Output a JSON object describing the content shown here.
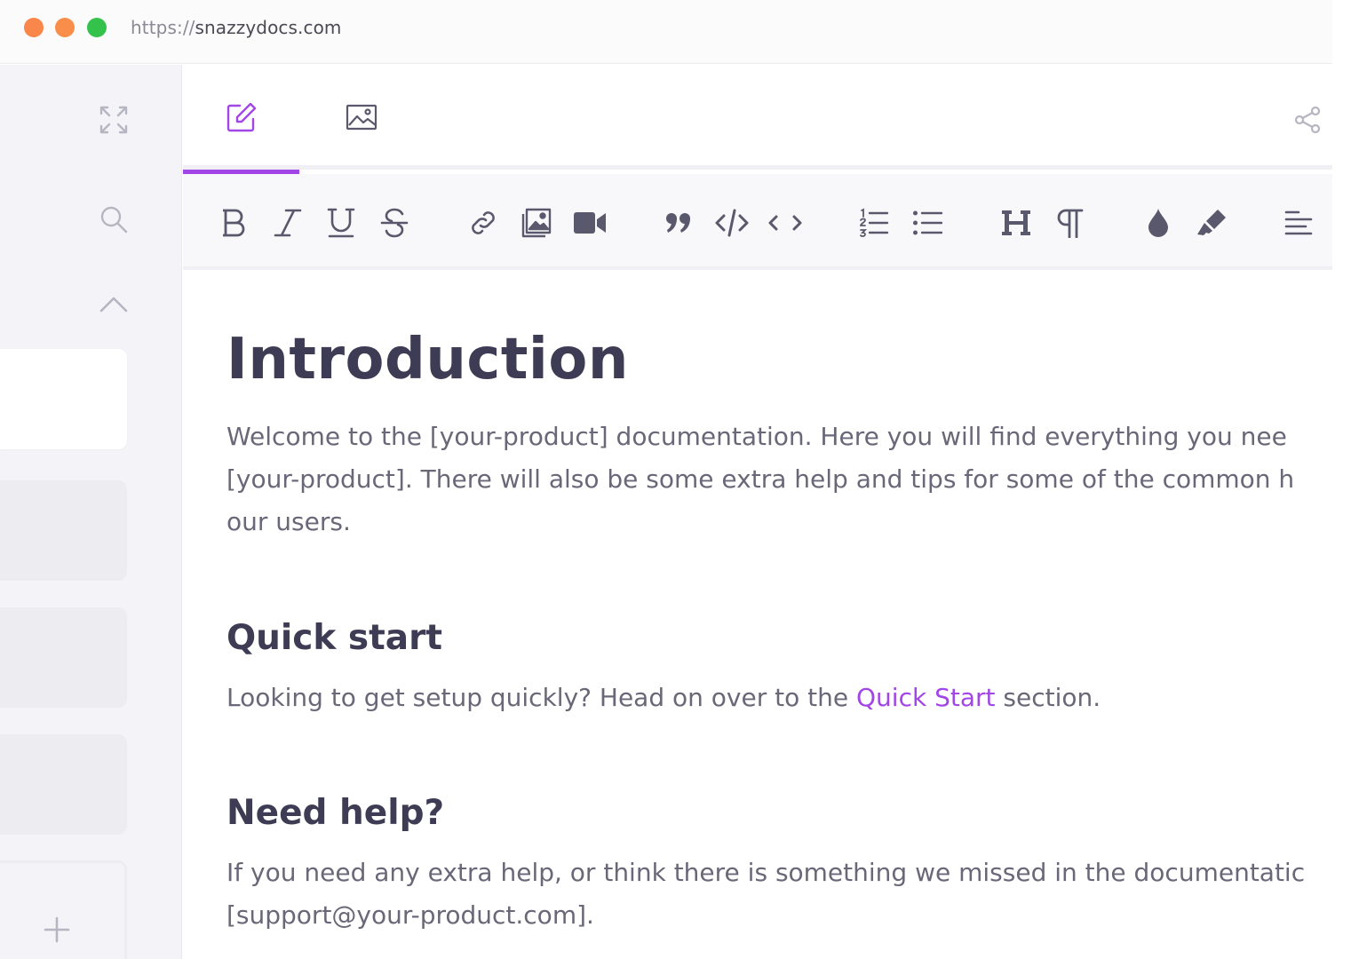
{
  "browser": {
    "url_protocol": "https://",
    "url_host": "snazzydocs.com"
  },
  "sidebar": {
    "icons": [
      "expand-icon",
      "search-icon",
      "chevron-up-icon"
    ],
    "add_icon": "plus-icon"
  },
  "tabs": [
    "edit-icon",
    "image-icon"
  ],
  "toolbar": {
    "groups": [
      [
        "bold",
        "italic",
        "underline",
        "strikethrough"
      ],
      [
        "link",
        "image",
        "video"
      ],
      [
        "quote",
        "code-block",
        "inline-code"
      ],
      [
        "ordered-list",
        "unordered-list"
      ],
      [
        "heading",
        "paragraph"
      ],
      [
        "color",
        "highlight"
      ],
      [
        "align"
      ]
    ]
  },
  "colors": {
    "accent": "#a246e8",
    "heading": "#3e3c55",
    "body_text": "#6a6878",
    "icon": "#5a586c"
  },
  "document": {
    "title": "Introduction",
    "intro_line1": "Welcome to the [your-product] documentation. Here you will find everything you nee",
    "intro_line2": "[your-product]. There will also be some extra help and tips for some of the common h",
    "intro_line3": "our users.",
    "quickstart_heading": "Quick start",
    "quickstart_text_before": "Looking to get setup quickly? Head on over to the ",
    "quickstart_link": "Quick Start",
    "quickstart_text_after": " section.",
    "help_heading": "Need help?",
    "help_line1": "If you need any extra help, or think there is something we missed in the documentatic",
    "help_line2": "[support@your-product.com]."
  }
}
